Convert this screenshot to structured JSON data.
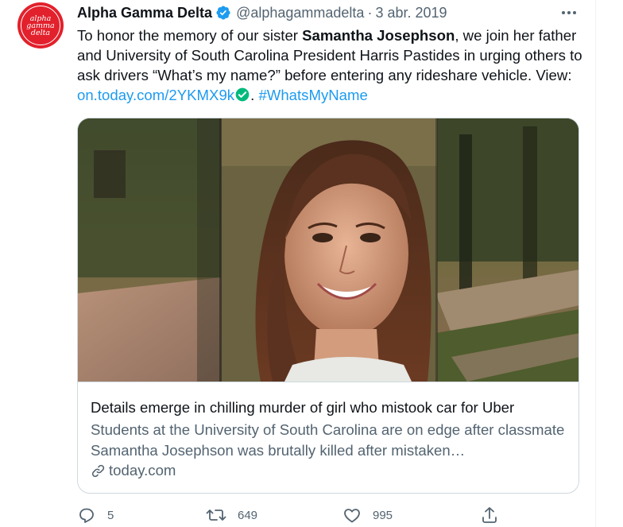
{
  "tweet": {
    "avatar_text": [
      "alpha",
      "gamma",
      "delta"
    ],
    "author_name": "Alpha Gamma Delta",
    "handle": "@alphagammadelta",
    "separator": "·",
    "date": "3 abr. 2019",
    "text": {
      "part1": "To honor the memory of our sister ",
      "bold": "Samantha Josephson",
      "part2": ", we join her father and University of South Carolina President Harris Pastides in urging others to ask drivers “What’s my name?” before entering any rideshare vehicle. View: ",
      "link": "on.today.com/2YKMX9k",
      "part3": ". ",
      "hashtag": "#WhatsMyName"
    }
  },
  "card": {
    "title": "Details emerge in chilling murder of girl who mistook car for Uber",
    "description": "Students at the University of South Carolina are on edge after classmate Samantha Josephson was brutally killed after mistaken…",
    "domain": "today.com"
  },
  "actions": {
    "replies": "5",
    "retweets": "649",
    "likes": "995"
  },
  "colors": {
    "accent": "#1d9bf0",
    "secondary_text": "#536471",
    "avatar_red": "#e2212c",
    "verified_green": "#00ba7c"
  },
  "icons": [
    "verified-badge-icon",
    "more-icon",
    "check-circle-icon",
    "link-icon",
    "reply-icon",
    "retweet-icon",
    "like-icon",
    "share-icon"
  ]
}
